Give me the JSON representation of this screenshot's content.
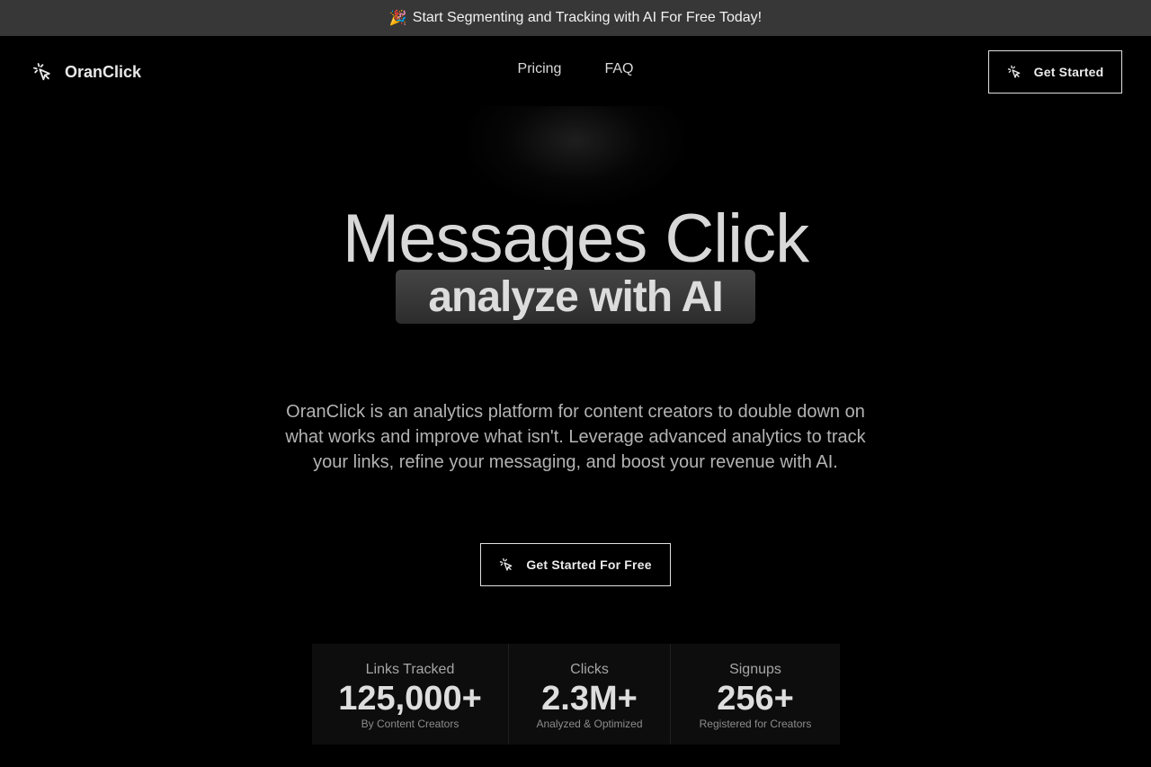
{
  "banner": {
    "emoji": "🎉",
    "text": "Start Segmenting and Tracking with AI For Free Today!"
  },
  "header": {
    "logo_icon": "cursor-click-icon",
    "brand": "OranClick",
    "nav": [
      {
        "label": "Pricing"
      },
      {
        "label": "FAQ"
      }
    ],
    "cta_label": "Get Started"
  },
  "hero": {
    "title": "Messages Click",
    "highlight": "analyze with AI",
    "description": "OranClick is an analytics platform for content creators to double down on what works and improve what isn't. Leverage advanced analytics to track your links, refine your messaging, and boost your revenue with AI.",
    "cta_label": "Get Started For Free"
  },
  "stats": [
    {
      "label": "Links Tracked",
      "value": "125,000+",
      "sub": "By Content Creators"
    },
    {
      "label": "Clicks",
      "value": "2.3M+",
      "sub": "Analyzed & Optimized"
    },
    {
      "label": "Signups",
      "value": "256+",
      "sub": "Registered for Creators"
    }
  ],
  "colors": {
    "background": "#000000",
    "banner": "#373737",
    "text": "#e6e6e6"
  }
}
